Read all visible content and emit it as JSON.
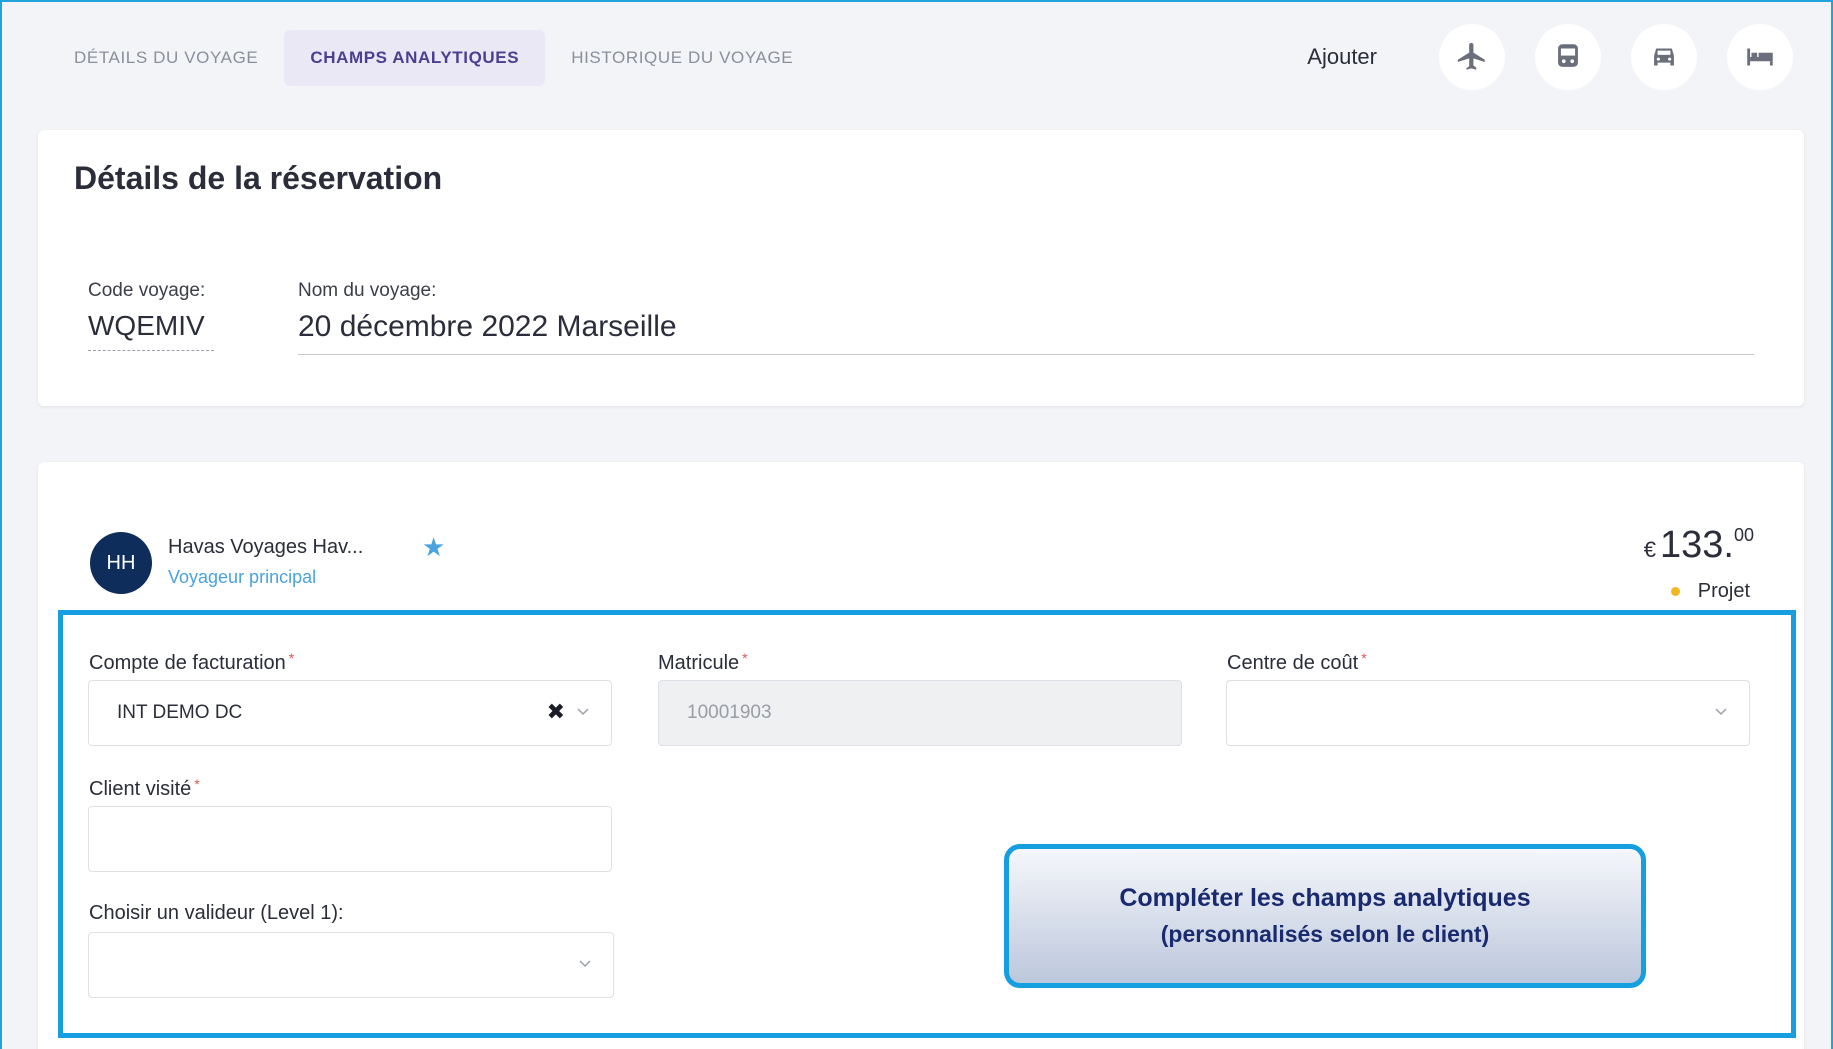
{
  "tabs": [
    {
      "label": "DÉTAILS DU VOYAGE",
      "active": false
    },
    {
      "label": "CHAMPS ANALYTIQUES",
      "active": true
    },
    {
      "label": "HISTORIQUE DU VOYAGE",
      "active": false
    }
  ],
  "add": {
    "label": "Ajouter",
    "buttons": [
      {
        "icon": "plane-icon"
      },
      {
        "icon": "train-icon"
      },
      {
        "icon": "car-icon"
      },
      {
        "icon": "hotel-bed-icon"
      }
    ]
  },
  "reservation": {
    "title": "Détails de la réservation",
    "code_label": "Code voyage:",
    "code_value": "WQEMIV",
    "name_label": "Nom du voyage:",
    "name_value": "20 décembre 2022 Marseille"
  },
  "traveler": {
    "initials": "HH",
    "name": "Havas Voyages Hav...",
    "role": "Voyageur principal",
    "price_currency": "€",
    "price_int": "133.",
    "price_dec": "00",
    "status": "Projet"
  },
  "fields": {
    "billing_label": "Compte de facturation",
    "billing_value": "INT DEMO DC",
    "matricule_label": "Matricule",
    "matricule_value": "10001903",
    "cost_center_label": "Centre de coût",
    "client_label": "Client visité",
    "approver_label": "Choisir un valideur (Level 1):"
  },
  "callout": {
    "line1": "Compléter les champs analytiques",
    "line2": "(personnalisés selon le client)"
  },
  "colors": {
    "accent": "#159ee0",
    "avatar": "#0f2d5a",
    "active_tab_bg": "#ebe8f6",
    "status_dot": "#f2b824"
  }
}
